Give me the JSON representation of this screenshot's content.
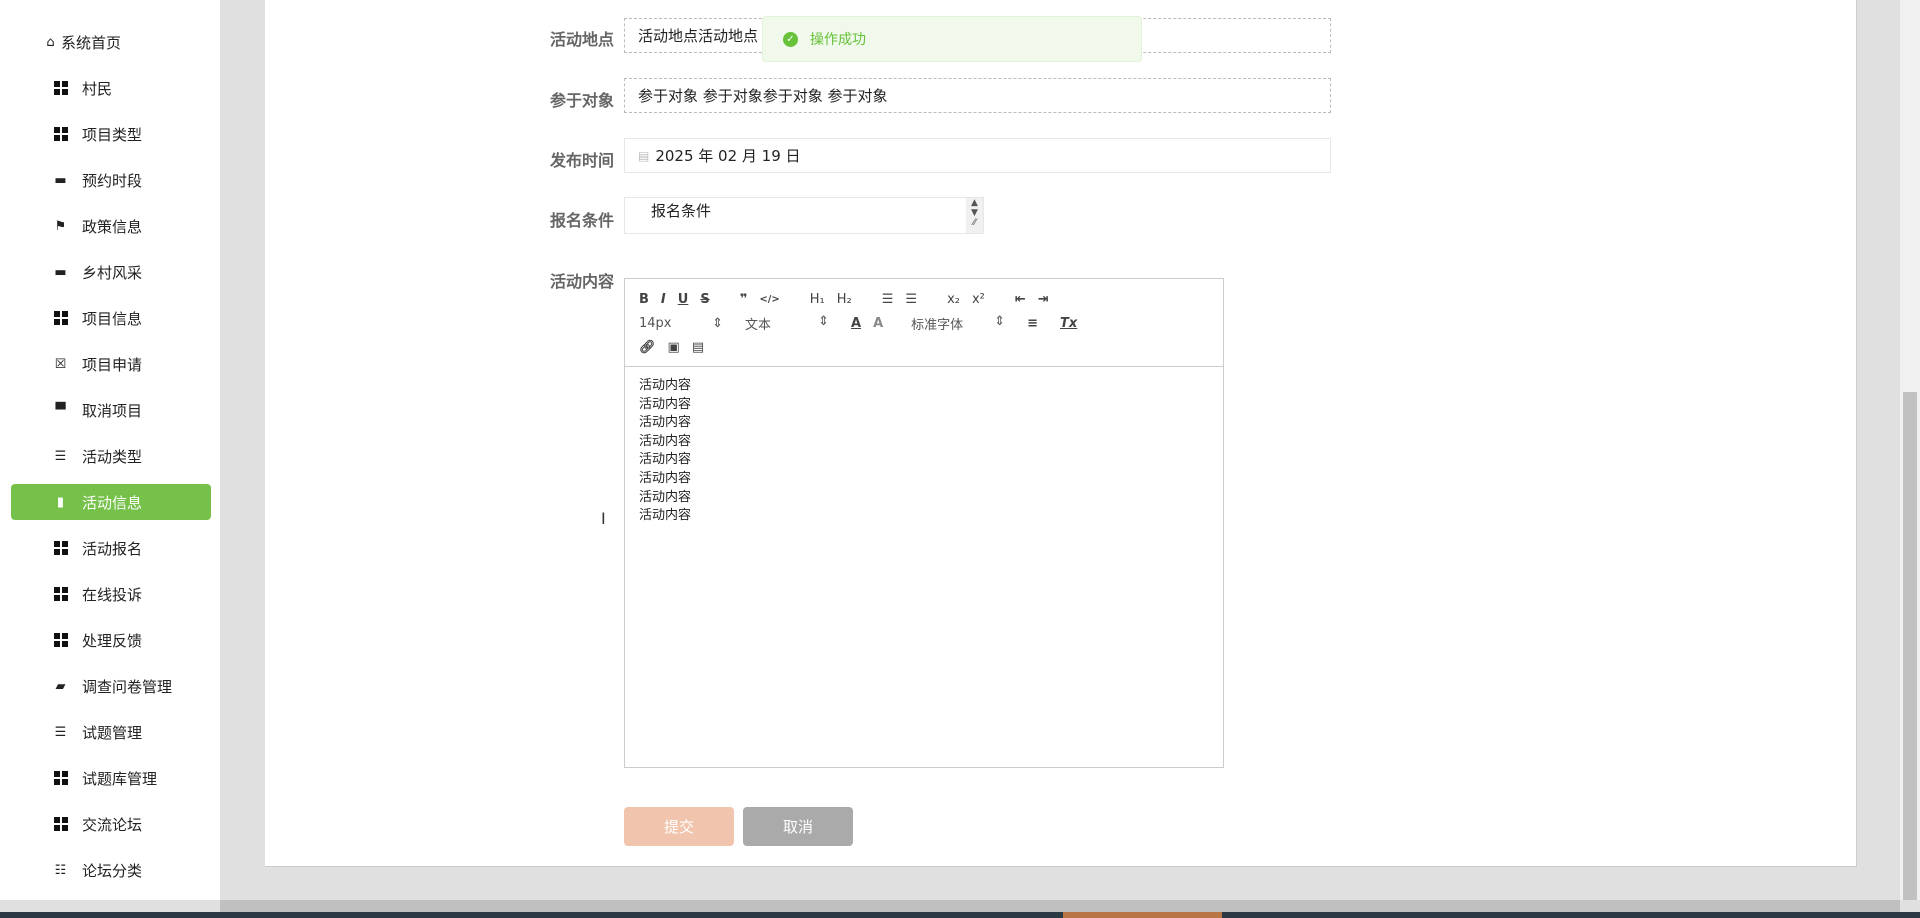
{
  "sidebar": {
    "items": [
      {
        "label": "系统首页",
        "icon": "home-icon"
      },
      {
        "label": "村民",
        "icon": "grid-icon"
      },
      {
        "label": "项目类型",
        "icon": "grid-icon"
      },
      {
        "label": "预约时段",
        "icon": "comment-icon"
      },
      {
        "label": "政策信息",
        "icon": "flag-icon"
      },
      {
        "label": "乡村风采",
        "icon": "briefcase-icon"
      },
      {
        "label": "项目信息",
        "icon": "grid-icon"
      },
      {
        "label": "项目申请",
        "icon": "clipboard-x-icon"
      },
      {
        "label": "取消项目",
        "icon": "monitor-icon"
      },
      {
        "label": "活动类型",
        "icon": "list-indent-icon"
      },
      {
        "label": "活动信息",
        "icon": "bar-chart-icon",
        "active": true
      },
      {
        "label": "活动报名",
        "icon": "grid-icon"
      },
      {
        "label": "在线投诉",
        "icon": "grid-icon"
      },
      {
        "label": "处理反馈",
        "icon": "grid-icon"
      },
      {
        "label": "调查问卷管理",
        "icon": "wallet-icon"
      },
      {
        "label": "试题管理",
        "icon": "list-icon"
      },
      {
        "label": "试题库管理",
        "icon": "grid-icon"
      },
      {
        "label": "交流论坛",
        "icon": "grid-icon"
      },
      {
        "label": "论坛分类",
        "icon": "sliders-icon"
      }
    ],
    "active_color": "#75c14a"
  },
  "form": {
    "location": {
      "label": "活动地点",
      "value": "活动地点活动地点"
    },
    "target": {
      "label": "参于对象",
      "value": "参于对象 参于对象参于对象 参于对象"
    },
    "publish_time": {
      "label": "发布时间",
      "value": "2025 年 02 月 19 日"
    },
    "condition": {
      "label": "报名条件",
      "value": "报名条件"
    },
    "content": {
      "label": "活动内容",
      "lines": [
        "活动内容",
        "活动内容",
        "活动内容",
        "活动内容",
        "活动内容",
        "活动内容",
        "活动内容",
        "活动内容"
      ]
    },
    "submit_label": "提交",
    "cancel_label": "取消",
    "submit_color": "#f0c4ad",
    "cancel_color": "#aaaaaa"
  },
  "editor": {
    "toolbar": {
      "size": "14px",
      "header": "文本",
      "font": "标准字体"
    }
  },
  "toast": {
    "message": "操作成功",
    "color": "#67c23a"
  }
}
